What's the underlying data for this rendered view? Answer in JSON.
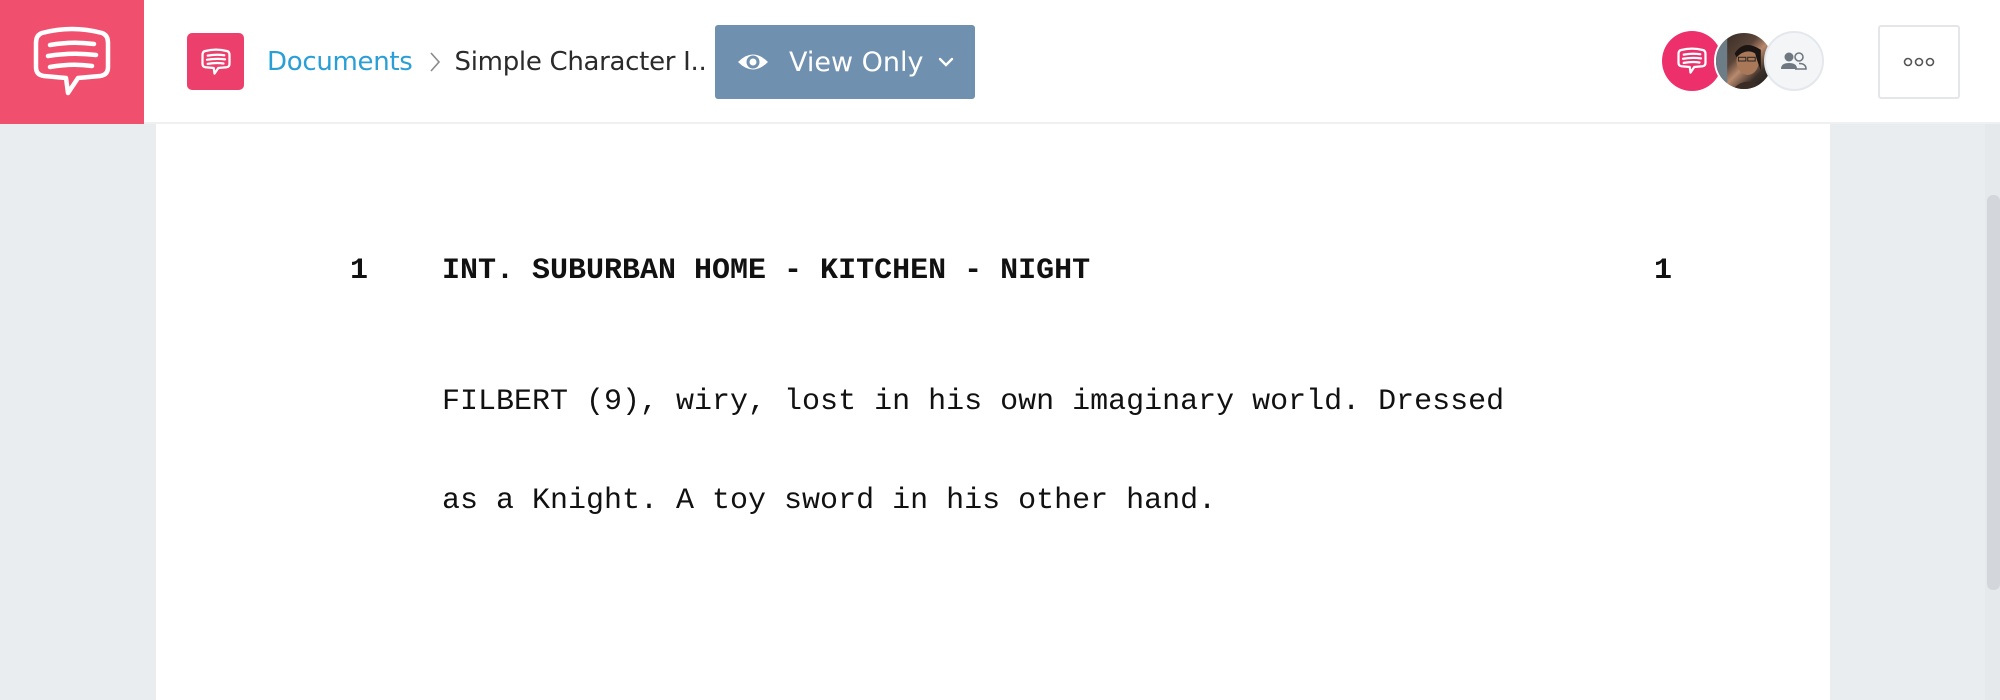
{
  "app": {
    "brand_color": "#f0506e",
    "logo_icon": "chat-bubble-icon"
  },
  "header": {
    "doc_badge_icon": "chat-bubble-icon",
    "breadcrumb": {
      "root_label": "Documents",
      "separator_icon": "chevron-right-icon",
      "current_label": "Simple Character I.."
    },
    "view_mode": {
      "label": "View Only",
      "icon": "eye-icon",
      "dropdown_icon": "chevron-down-icon",
      "color": "#7090b0"
    },
    "collaborators": [
      {
        "type": "app",
        "icon": "chat-bubble-icon"
      },
      {
        "type": "user-photo"
      },
      {
        "type": "share",
        "icon": "users-icon"
      }
    ],
    "more_icon": "more-horizontal-icon"
  },
  "document": {
    "scenes": [
      {
        "number_left": "1",
        "heading": "INT. SUBURBAN HOME - KITCHEN - NIGHT",
        "number_right": "1",
        "action_lines": [
          "FILBERT (9), wiry, lost in his own imaginary world. Dressed",
          "as a Knight. A toy sword in his other hand."
        ]
      }
    ]
  }
}
